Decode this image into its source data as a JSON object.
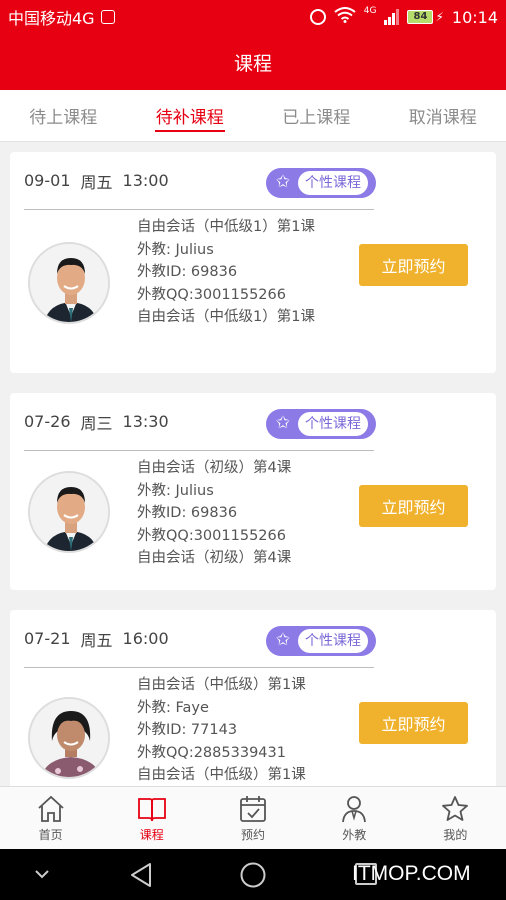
{
  "status": {
    "carrier": "中国移动4G",
    "net_type": "4G",
    "battery": "84",
    "time": "10:14"
  },
  "header": {
    "title": "课程"
  },
  "tabs": [
    {
      "label": "待上课程"
    },
    {
      "label": "待补课程",
      "active": true
    },
    {
      "label": "已上课程"
    },
    {
      "label": "取消课程"
    }
  ],
  "courses": [
    {
      "date": "09-01",
      "weekday": "周五",
      "time": "13:00",
      "badge": "个性课程",
      "lines": [
        "自由会话（中低级1）第1课",
        "外教: Julius",
        "外教ID: 69836",
        "外教QQ:3001155266",
        "自由会话（中低级1）第1课"
      ],
      "button": "立即预约",
      "avatar": "male-teacher"
    },
    {
      "date": "07-26",
      "weekday": "周三",
      "time": "13:30",
      "badge": "个性课程",
      "lines": [
        "自由会话（初级）第4课",
        "外教: Julius",
        "外教ID: 69836",
        "外教QQ:3001155266",
        "自由会话（初级）第4课"
      ],
      "button": "立即预约",
      "avatar": "male-teacher"
    },
    {
      "date": "07-21",
      "weekday": "周五",
      "time": "16:00",
      "badge": "个性课程",
      "lines": [
        "自由会话（中低级）第1课",
        "外教: Faye",
        "外教ID: 77143",
        "外教QQ:2885339431",
        "自由会话（中低级）第1课"
      ],
      "button": "立即预约",
      "avatar": "female-teacher"
    }
  ],
  "bottom_nav": [
    {
      "label": "首页",
      "icon": "home-icon"
    },
    {
      "label": "课程",
      "icon": "book-icon",
      "active": true
    },
    {
      "label": "预约",
      "icon": "calendar-check-icon"
    },
    {
      "label": "外教",
      "icon": "teacher-icon"
    },
    {
      "label": "我的",
      "icon": "star-icon"
    }
  ],
  "watermark": "ITMOP.COM",
  "colors": {
    "brand": "#e60012",
    "button": "#f0b22d",
    "badge": "#8c7ae6"
  }
}
